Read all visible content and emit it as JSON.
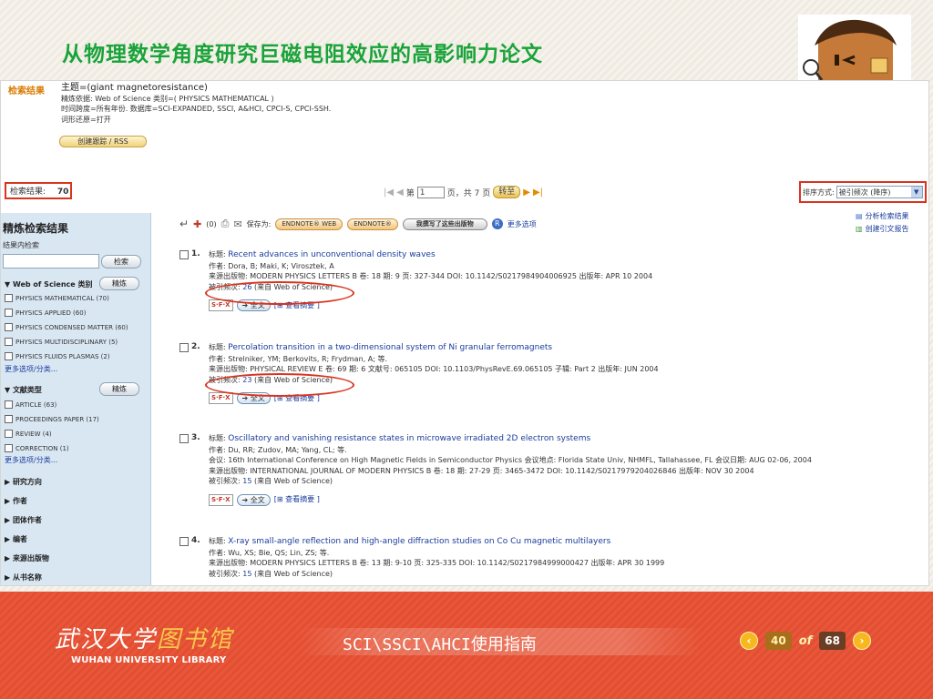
{
  "slide": {
    "title": "从物理数学角度研究巨磁电阻效应的高影响力论文"
  },
  "query": {
    "label": "检索结果",
    "topic": "主题=(giant magnetoresistance)",
    "refine": "精炼依据: Web of Science 类别=( PHYSICS MATHEMATICAL )",
    "timespan": "时间跨度=所有年份. 数据库=SCI-EXPANDED, SSCI, A&HCI, CPCI-S, CPCI-SSH.",
    "lemma": "词形还原=打开",
    "rss_label": "创建跟踪 / RSS"
  },
  "results": {
    "count_label": "检索结果:",
    "count": "70"
  },
  "pager": {
    "prefix": "第",
    "page": "1",
    "suffix": "页，共 7 页",
    "go": "转至"
  },
  "sort": {
    "label": "排序方式:",
    "value": "被引频次 (降序)"
  },
  "sidebar": {
    "title": "精炼检索结果",
    "search_within": "结果内检索",
    "search_btn": "检索",
    "refine_btn": "精炼",
    "wos_head": "Web of Science 类别",
    "wos_items": [
      "PHYSICS MATHEMATICAL (70)",
      "PHYSICS APPLIED (60)",
      "PHYSICS CONDENSED MATTER (60)",
      "PHYSICS MULTIDISCIPLINARY (5)",
      "PHYSICS FLUIDS PLASMAS (2)"
    ],
    "more": "更多选项/分类...",
    "doc_head": "文献类型",
    "doc_items": [
      "ARTICLE (63)",
      "PROCEEDINGS PAPER (17)",
      "REVIEW (4)",
      "CORRECTION (1)"
    ],
    "collapsed": [
      "研究方向",
      "作者",
      "团体作者",
      "编者",
      "来源出版物",
      "从书名称"
    ]
  },
  "toolbar": {
    "marked": "(0)",
    "save_to": "保存为:",
    "endnote_web": "ENDNOTE® WEB",
    "endnote": "ENDNOTE®",
    "my_pubs": "我撰写了这些出版物",
    "more": "更多选项"
  },
  "right_links": {
    "analyze": "分析检索结果",
    "citation_report": "创建引文报告"
  },
  "records": [
    {
      "num": "1.",
      "title_prefix": "标题:",
      "title": "Recent advances in unconventional density waves",
      "authors": "作者: Dora, B; Maki, K; Virosztek, A",
      "source": "来源出版物: MODERN PHYSICS LETTERS B  卷: 18  期: 9  页: 327-344  DOI: 10.1142/S0217984904006925  出版年: APR 10 2004",
      "conf": "",
      "cited_prefix": "被引频次:",
      "cited": "26",
      "cited_suffix": "(来自 Web of Science)"
    },
    {
      "num": "2.",
      "title_prefix": "标题:",
      "title": "Percolation transition in a two-dimensional system of Ni granular ferromagnets",
      "authors": "作者: Strelniker, YM; Berkovits, R; Frydman, A; 等.",
      "source": "来源出版物: PHYSICAL REVIEW E  卷: 69  期: 6   文献号: 065105  DOI: 10.1103/PhysRevE.69.065105  子辑: Part 2  出版年: JUN 2004",
      "conf": "",
      "cited_prefix": "被引频次:",
      "cited": "23",
      "cited_suffix": "(来自 Web of Science)"
    },
    {
      "num": "3.",
      "title_prefix": "标题:",
      "title": "Oscillatory and vanishing resistance states in microwave irradiated 2D electron systems",
      "authors": "作者: Du, RR; Zudov, MA; Yang, CL; 等.",
      "conf": "会议: 16th International Conference on High Magnetic Fields in Semiconductor Physics 会议地点: Florida State Univ, NHMFL, Tallahassee, FL 会议日期: AUG 02-06, 2004",
      "source": "来源出版物: INTERNATIONAL JOURNAL OF MODERN PHYSICS B  卷: 18  期: 27-29  页: 3465-3472  DOI: 10.1142/S0217979204026846  出版年: NOV 30 2004",
      "cited_prefix": "被引频次:",
      "cited": "15",
      "cited_suffix": "(来自 Web of Science)"
    },
    {
      "num": "4.",
      "title_prefix": "标题:",
      "title": "X-ray small-angle reflection and high-angle diffraction studies on Co Cu magnetic multilayers",
      "authors": "作者: Wu, XS; Bie, QS; Lin, ZS; 等.",
      "source": "来源出版物: MODERN PHYSICS LETTERS B  卷: 13  期: 9-10  页: 325-335  DOI: 10.1142/S0217984999000427  出版年: APR 30 1999",
      "conf": "",
      "cited_prefix": "被引频次:",
      "cited": "15",
      "cited_suffix": "(来自 Web of Science)"
    }
  ],
  "record_tools": {
    "sfx": "S·F·X",
    "fulltext": "全文",
    "abstract": "[⊞ 查看摘要 ]"
  },
  "footer": {
    "logo_cn_a": "武汉大学",
    "logo_cn_b": "图书馆",
    "logo_en": "WUHAN UNIVERSITY LIBRARY",
    "text": "SCI\\SSCI\\AHCI使用指南",
    "of": "of",
    "current": "40",
    "total": "68"
  },
  "colors": {
    "title_green": "#1aa33a",
    "footer_red": "#e9573a",
    "highlight_red": "#d9341f",
    "link_blue": "#1a3c9c"
  }
}
